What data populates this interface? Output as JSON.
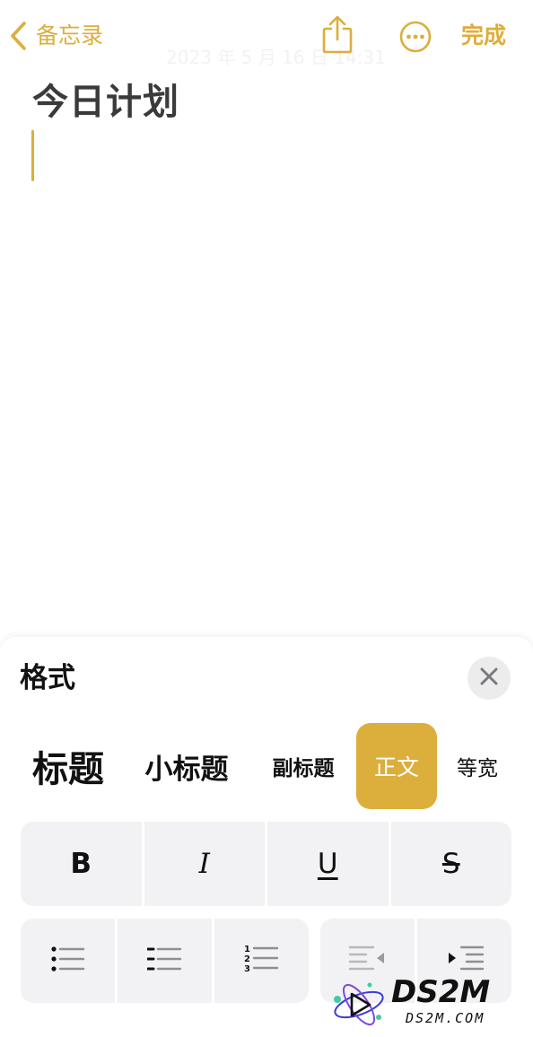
{
  "nav": {
    "back_label": "备忘录",
    "done_label": "完成"
  },
  "note": {
    "date": "2023 年 5 月 16 日 14:31",
    "title": "今日计划"
  },
  "format_panel": {
    "title": "格式",
    "styles": {
      "heading": "标题",
      "subheading": "小标题",
      "subtitle": "副标题",
      "body": "正文",
      "mono": "等宽"
    },
    "selected_style": "body",
    "text_buttons": {
      "bold": "B",
      "italic": "I",
      "underline": "U",
      "strikethrough": "S"
    }
  },
  "watermark": {
    "brand": "DS2M",
    "site": "DS2M.COM"
  },
  "colors": {
    "accent": "#dcae3c",
    "button_bg": "#f2f2f4",
    "title_text": "#3a3a3c"
  },
  "icons": {
    "back": "chevron-left-icon",
    "share": "share-icon",
    "more": "ellipsis-circle-icon",
    "close": "close-icon",
    "bullet_list": "bullet-list-icon",
    "dash_list": "dash-list-icon",
    "numbered_list": "numbered-list-icon",
    "outdent": "outdent-icon",
    "indent": "indent-icon"
  }
}
